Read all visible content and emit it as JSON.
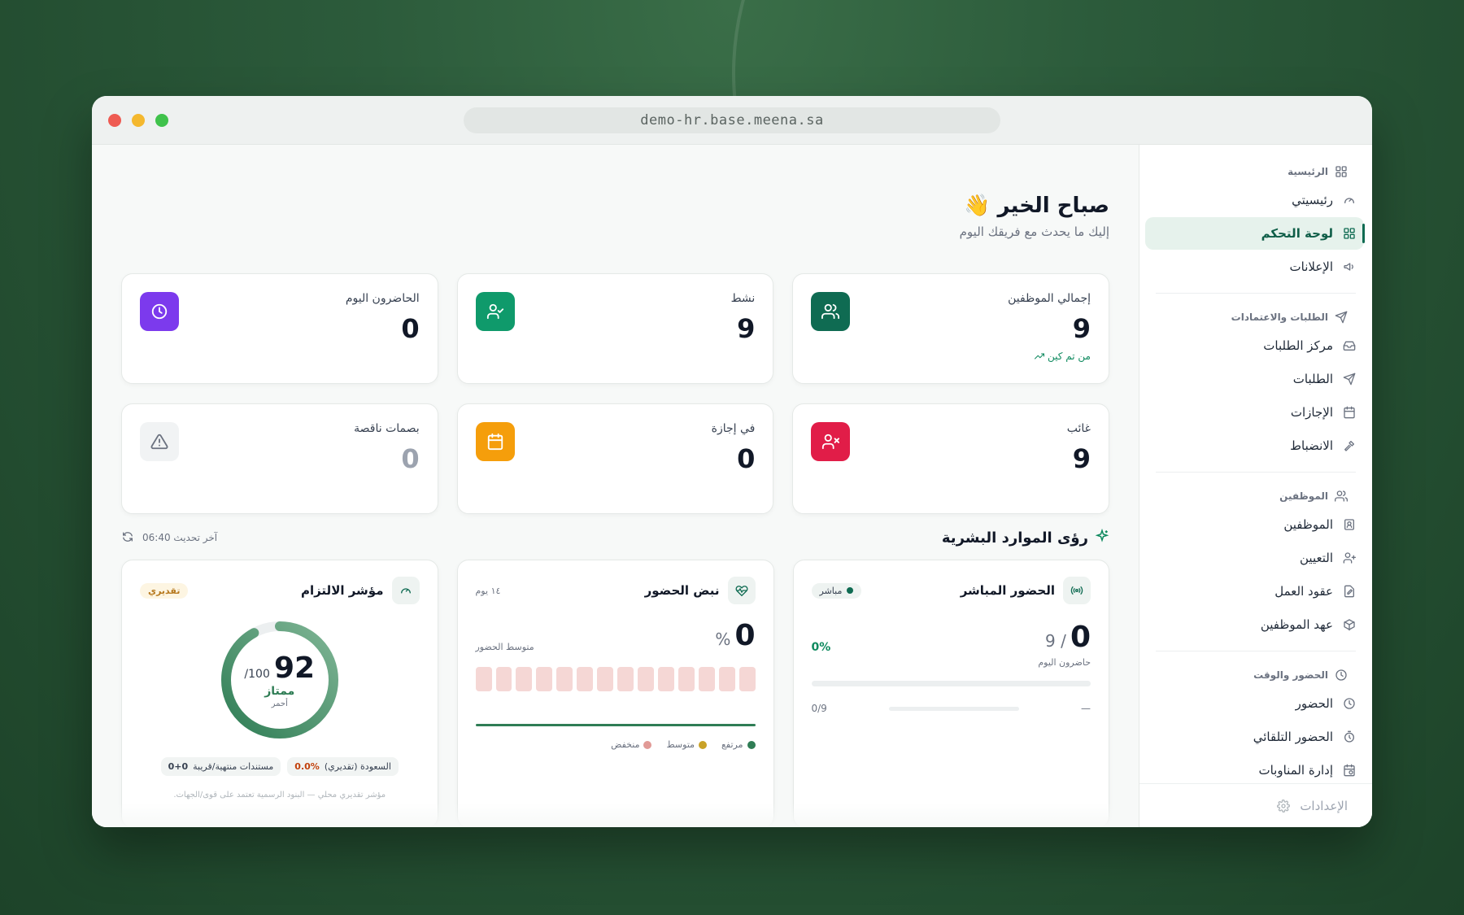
{
  "browser": {
    "url": "demo-hr.base.meena.sa"
  },
  "sidebar": {
    "sections": [
      {
        "heading": "الرئيسية",
        "icon": "grid-icon",
        "items": [
          {
            "label": "رئيسيتي",
            "icon": "gauge-icon",
            "active": false
          },
          {
            "label": "لوحة التحكم",
            "icon": "grid-icon",
            "active": true
          },
          {
            "label": "الإعلانات",
            "icon": "megaphone-icon",
            "active": false
          }
        ]
      },
      {
        "heading": "الطلبات والاعتمادات",
        "icon": "send-icon",
        "items": [
          {
            "label": "مركز الطلبات",
            "icon": "inbox-icon",
            "active": false
          },
          {
            "label": "الطلبات",
            "icon": "send-icon",
            "active": false
          },
          {
            "label": "الإجازات",
            "icon": "calendar-icon",
            "active": false
          },
          {
            "label": "الانضباط",
            "icon": "gavel-icon",
            "active": false
          }
        ]
      },
      {
        "heading": "الموظفين",
        "icon": "users-icon",
        "items": [
          {
            "label": "الموظفين",
            "icon": "id-badge-icon",
            "active": false
          },
          {
            "label": "التعيين",
            "icon": "user-plus-icon",
            "active": false
          },
          {
            "label": "عقود العمل",
            "icon": "file-edit-icon",
            "active": false
          },
          {
            "label": "عهد الموظفين",
            "icon": "box-icon",
            "active": false
          }
        ]
      },
      {
        "heading": "الحضور والوقت",
        "icon": "clock-icon",
        "items": [
          {
            "label": "الحضور",
            "icon": "clock-icon",
            "active": false
          },
          {
            "label": "الحضور التلقائي",
            "icon": "timer-icon",
            "active": false
          },
          {
            "label": "إدارة المناوبات",
            "icon": "calendar-clock-icon",
            "active": false
          }
        ]
      }
    ],
    "footer_label": "الإعدادات"
  },
  "greeting": {
    "title": "صباح الخير 👋",
    "subtitle": "إليك ما يحدث مع فريقك اليوم"
  },
  "stats": [
    {
      "label": "إجمالي الموظفين",
      "value": "9",
      "trend": "من تم كين",
      "icon": "users-icon",
      "color": "#0f6b52"
    },
    {
      "label": "نشط",
      "value": "9",
      "icon": "user-check-icon",
      "color": "#0f9a6b"
    },
    {
      "label": "الحاضرون اليوم",
      "value": "0",
      "icon": "clock-icon",
      "color": "#7c3aed"
    },
    {
      "label": "غائب",
      "value": "9",
      "icon": "user-x-icon",
      "color": "#e11d48"
    },
    {
      "label": "في إجازة",
      "value": "0",
      "icon": "calendar-icon",
      "color": "#f59e0b"
    },
    {
      "label": "بصمات ناقصة",
      "value": "0",
      "icon": "warning-icon",
      "color": "#f1f3f4"
    }
  ],
  "insights": {
    "title": "رؤى الموارد البشرية",
    "last_update_label": "آخر تحديث 06:40",
    "live": {
      "title": "الحضور المباشر",
      "badge": "مباشر",
      "present": "0",
      "total": "/ 9",
      "percent": "0%",
      "present_label": "حاضرون اليوم",
      "ratio": "0/9",
      "dash": "—"
    },
    "pulse": {
      "title": "نبض الحضور",
      "period": "١٤ يوم",
      "value": "0",
      "unit": "%",
      "label": "متوسط الحضور",
      "days": 14,
      "legend": [
        "مرتفع",
        "متوسط",
        "منخفض"
      ],
      "legend_colors": [
        "#2f7d55",
        "#c9a227",
        "#e19a96"
      ]
    },
    "compliance": {
      "title": "مؤشر الالتزام",
      "badge": "تقديري",
      "score": 92,
      "score_text": "92",
      "out_of": "/100",
      "rating": "ممتاز",
      "rating_sub": "أحمر",
      "chip1_label": "السعودة (تقديري)",
      "chip1_value": "0.0%",
      "chip2_label": "مستندات منتهية/قريبة",
      "chip2_value": "0+0",
      "footnote": "مؤشر تقديري محلي — البنود الرسمية تعتمد على قوى/الجهات."
    }
  }
}
